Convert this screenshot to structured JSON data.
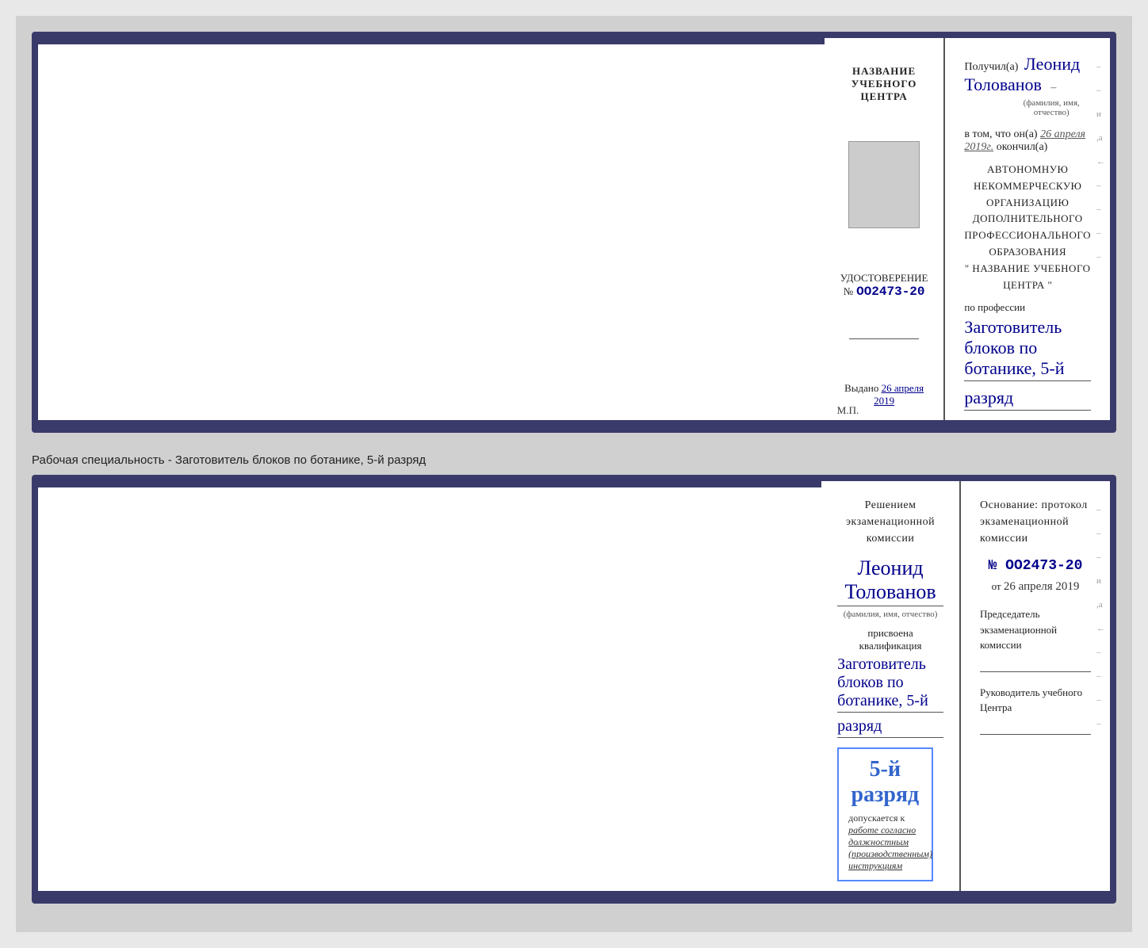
{
  "background_color": "#d0d0d0",
  "top_document": {
    "left": {
      "center_title": "НАЗВАНИЕ УЧЕБНОГО ЦЕНТРА",
      "cert_label": "УДОСТОВЕРЕНИЕ",
      "cert_number_prefix": "№",
      "cert_number": "OO2473-20",
      "issued_label": "Выдано",
      "issued_date": "26 апреля 2019",
      "mp_label": "М.П."
    },
    "right": {
      "received_label": "Получил(а)",
      "recipient_name": "Леонид Толованов",
      "fio_subtitle": "(фамилия, имя, отчество)",
      "confirm_text": "в том, что он(а)",
      "confirm_date": "26 апреля 2019г.",
      "confirm_end": "окончил(а)",
      "org_line1": "АВТОНОМНУЮ НЕКОММЕРЧЕСКУЮ ОРГАНИЗАЦИЮ",
      "org_line2": "ДОПОЛНИТЕЛЬНОГО ПРОФЕССИОНАЛЬНОГО ОБРАЗОВАНИЯ",
      "org_line3": "\"   НАЗВАНИЕ УЧЕБНОГО ЦЕНТРА   \"",
      "profession_label": "по профессии",
      "profession_value": "Заготовитель блоков по ботанике, 5-й",
      "rank_value": "разряд"
    }
  },
  "specialty_label": "Рабочая специальность - Заготовитель блоков по ботанике, 5-й разряд",
  "bottom_document": {
    "left": {
      "commission_text": "Решением экзаменационной комиссии",
      "person_name": "Леонид Толованов",
      "fio_subtitle": "(фамилия, имя, отчество)",
      "qualification_label": "присвоена квалификация",
      "qualification_value": "Заготовитель блоков по ботанике, 5-й",
      "rank_value": "разряд",
      "rank_display": "5-й разряд",
      "allowed_label": "допускается к",
      "allowed_text": "работе согласно должностным (производственным) инструкциям"
    },
    "right": {
      "basis_text": "Основание: протокол экзаменационной комиссии",
      "protocol_number": "№  OO2473-20",
      "from_label": "от",
      "from_date": "26 апреля 2019",
      "chairman_title": "Председатель экзаменационной комиссии",
      "head_title": "Руководитель учебного Центра"
    }
  }
}
